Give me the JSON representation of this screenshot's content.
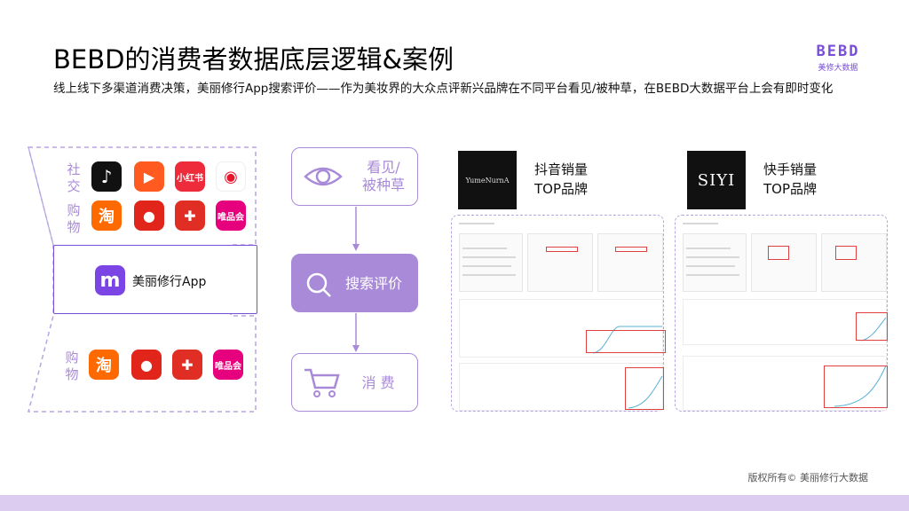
{
  "header": {
    "title": "BEBD的消费者数据底层逻辑&案例",
    "subtitle": "线上线下多渠道消费决策，美丽修行App搜索评价——作为美妆界的大众点评新兴品牌在不同平台看见/被种草，在BEBD大数据平台上会有即时变化"
  },
  "logo": {
    "mark": "BEBD",
    "sub": "美修大数据"
  },
  "funnel": {
    "top_label_1": "社交",
    "top_label_2": "购物",
    "bottom_label": "购物",
    "center_app": "美丽修行App",
    "center_app_letter": "m",
    "social_apps": [
      {
        "icon": "douyin-icon",
        "glyph": "♪"
      },
      {
        "icon": "kuaishou-icon",
        "glyph": "▶"
      },
      {
        "icon": "xiaohongshu-icon",
        "glyph": "小红书"
      },
      {
        "icon": "weibo-icon",
        "glyph": "◉"
      }
    ],
    "shop_apps": [
      {
        "icon": "taobao-icon",
        "glyph": "淘"
      },
      {
        "icon": "jd-icon",
        "glyph": "●"
      },
      {
        "icon": "pinduoduo-icon",
        "glyph": "✚"
      },
      {
        "icon": "vipshop-icon",
        "glyph": "唯品会"
      }
    ]
  },
  "flow": {
    "step1": "看见/\n被种草",
    "step1_line1": "看见/",
    "step1_line2": "被种草",
    "step2": "搜索评价",
    "step3": "消 费"
  },
  "panels": {
    "left": {
      "title_line1": "抖音销量",
      "title_line2": "TOP品牌",
      "brand_text": "YumeNurnA"
    },
    "right": {
      "title_line1": "快手销量",
      "title_line2": "TOP品牌",
      "brand_text": "SIYI"
    }
  },
  "copyright": "版权所有© 美丽修行大数据",
  "colors": {
    "accent": "#a98ad8",
    "brand_purple": "#7a4fd8",
    "footer": "#dccdf0"
  }
}
